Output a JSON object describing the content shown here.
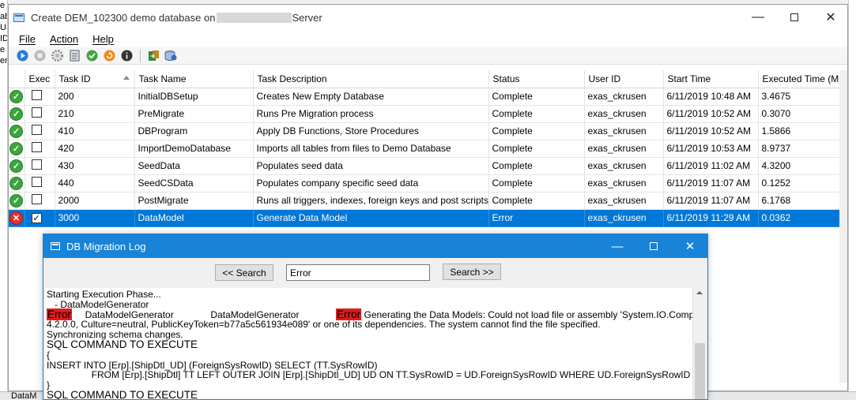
{
  "background": {
    "left_fragments": [
      "e Dest",
      "ab",
      "US",
      "ID",
      "e",
      "",
      "erv"
    ],
    "bottom_text": "DataM"
  },
  "main_window": {
    "title_prefix": "Create DEM_102300 demo database on",
    "title_suffix": "Server",
    "menu": [
      "File",
      "Action",
      "Help"
    ],
    "toolbar_icons": [
      "play-icon",
      "stop-icon",
      "settings-gear-icon",
      "document-icon",
      "check-icon",
      "refresh-icon",
      "info-icon",
      "export-icon",
      "database-icon"
    ],
    "columns": [
      "",
      "Exec",
      "Task ID",
      "Task Name",
      "Task Description",
      "Status",
      "User ID",
      "Start Time",
      "Executed Time (Min)"
    ],
    "rows": [
      {
        "state": "ok",
        "exec": false,
        "task_id": "200",
        "task_name": "InitialDBSetup",
        "description": "Creates New Empty Database",
        "status": "Complete",
        "user": "exas_ckrusen",
        "start": "6/11/2019 10:48 AM",
        "time": "3.4675"
      },
      {
        "state": "ok",
        "exec": false,
        "task_id": "210",
        "task_name": "PreMigrate",
        "description": "Runs Pre Migration process",
        "status": "Complete",
        "user": "exas_ckrusen",
        "start": "6/11/2019 10:52 AM",
        "time": "0.3070"
      },
      {
        "state": "ok",
        "exec": false,
        "task_id": "410",
        "task_name": "DBProgram",
        "description": "Apply DB Functions, Store Procedures",
        "status": "Complete",
        "user": "exas_ckrusen",
        "start": "6/11/2019 10:52 AM",
        "time": "1.5866"
      },
      {
        "state": "ok",
        "exec": false,
        "task_id": "420",
        "task_name": "ImportDemoDatabase",
        "description": "Imports all tables from files to Demo Database",
        "status": "Complete",
        "user": "exas_ckrusen",
        "start": "6/11/2019 10:53 AM",
        "time": "8.9737"
      },
      {
        "state": "ok",
        "exec": false,
        "task_id": "430",
        "task_name": "SeedData",
        "description": "Populates seed data",
        "status": "Complete",
        "user": "exas_ckrusen",
        "start": "6/11/2019 11:02 AM",
        "time": "4.3200"
      },
      {
        "state": "ok",
        "exec": false,
        "task_id": "440",
        "task_name": "SeedCSData",
        "description": "Populates company specific seed data",
        "status": "Complete",
        "user": "exas_ckrusen",
        "start": "6/11/2019 11:07 AM",
        "time": "0.1252"
      },
      {
        "state": "ok",
        "exec": false,
        "task_id": "2000",
        "task_name": "PostMigrate",
        "description": "Runs all triggers, indexes, foreign keys and post scripts",
        "status": "Complete",
        "user": "exas_ckrusen",
        "start": "6/11/2019 11:07 AM",
        "time": "6.1768"
      },
      {
        "state": "error",
        "exec": true,
        "task_id": "3000",
        "task_name": "DataModel",
        "description": "Generate Data Model",
        "status": "Error",
        "user": "exas_ckrusen",
        "start": "6/11/2019 11:29 AM",
        "time": "0.0362"
      }
    ]
  },
  "log_window": {
    "title": "DB Migration Log",
    "search_prev": "<< Search",
    "search_next": "Search >>",
    "search_value": "Error",
    "lines": {
      "l1": "Starting Execution Phase...",
      "l2": "   - DataModelGenerator",
      "l3_hl1": "Error",
      "l3_a": "     DataModelGenerator              DataModelGenerator              ",
      "l3_hl2": "Error",
      "l3_b": " Generating the Data Models: Could not load file or assembly 'System.IO.Compression, Version=",
      "l4": "4.2.0.0, Culture=neutral, PublicKeyToken=b77a5c561934e089' or one of its dependencies. The system cannot find the file specified.",
      "l5": "Synchronizing schema changes.",
      "l6": "SQL COMMAND TO EXECUTE",
      "l7": "{",
      "l8": "INSERT INTO [Erp].[ShipDtl_UD] (ForeignSysRowID) SELECT (TT.SysRowID)",
      "l9": "                 FROM [Erp].[ShipDtl] TT LEFT OUTER JOIN [Erp].[ShipDtl_UD] UD ON TT.SysRowID = UD.ForeignSysRowID WHERE UD.ForeignSysRowID IS NULL",
      "l10": "}",
      "l11": "SQL COMMAND TO EXECUTE"
    }
  },
  "colors": {
    "selection": "#0078d7",
    "log_titlebar": "#1883d7",
    "highlight": "#e41b1b",
    "ok": "#3ca63c",
    "error": "#e43030"
  }
}
